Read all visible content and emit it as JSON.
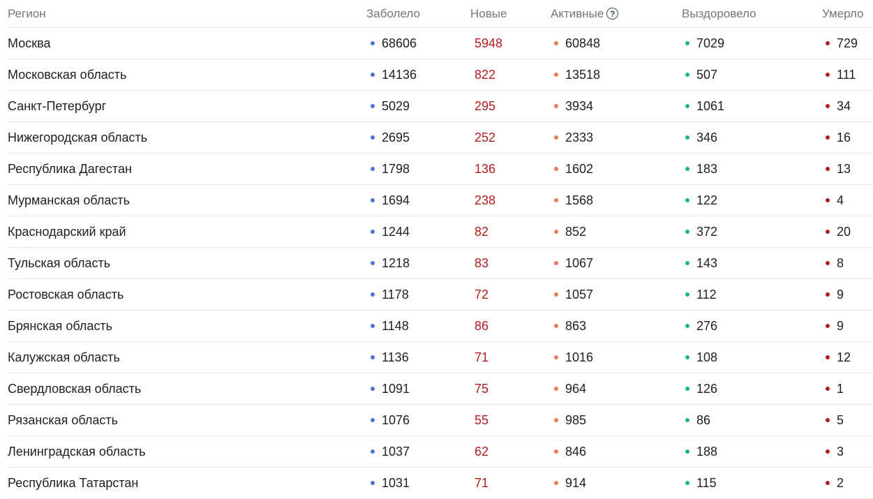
{
  "header": {
    "region": "Регион",
    "infected": "Заболело",
    "new": "Новые",
    "active": "Активные",
    "active_help": "?",
    "recovered": "Выздоровело",
    "deaths": "Умерло"
  },
  "colors": {
    "infected_dot": "#4a74d9",
    "active_dot": "#ef7a55",
    "recovered_dot": "#19b48c",
    "deaths_dot": "#b71c1c",
    "new_text": "#b71c1c"
  },
  "rows": [
    {
      "region": "Москва",
      "infected": "68606",
      "new": "5948",
      "active": "60848",
      "recovered": "7029",
      "deaths": "729"
    },
    {
      "region": "Московская область",
      "infected": "14136",
      "new": "822",
      "active": "13518",
      "recovered": "507",
      "deaths": "111"
    },
    {
      "region": "Санкт-Петербург",
      "infected": "5029",
      "new": "295",
      "active": "3934",
      "recovered": "1061",
      "deaths": "34"
    },
    {
      "region": "Нижегородская область",
      "infected": "2695",
      "new": "252",
      "active": "2333",
      "recovered": "346",
      "deaths": "16"
    },
    {
      "region": "Республика Дагестан",
      "infected": "1798",
      "new": "136",
      "active": "1602",
      "recovered": "183",
      "deaths": "13"
    },
    {
      "region": "Мурманская область",
      "infected": "1694",
      "new": "238",
      "active": "1568",
      "recovered": "122",
      "deaths": "4"
    },
    {
      "region": "Краснодарский край",
      "infected": "1244",
      "new": "82",
      "active": "852",
      "recovered": "372",
      "deaths": "20"
    },
    {
      "region": "Тульская область",
      "infected": "1218",
      "new": "83",
      "active": "1067",
      "recovered": "143",
      "deaths": "8"
    },
    {
      "region": "Ростовская область",
      "infected": "1178",
      "new": "72",
      "active": "1057",
      "recovered": "112",
      "deaths": "9"
    },
    {
      "region": "Брянская область",
      "infected": "1148",
      "new": "86",
      "active": "863",
      "recovered": "276",
      "deaths": "9"
    },
    {
      "region": "Калужская область",
      "infected": "1136",
      "new": "71",
      "active": "1016",
      "recovered": "108",
      "deaths": "12"
    },
    {
      "region": "Свердловская область",
      "infected": "1091",
      "new": "75",
      "active": "964",
      "recovered": "126",
      "deaths": "1"
    },
    {
      "region": "Рязанская область",
      "infected": "1076",
      "new": "55",
      "active": "985",
      "recovered": "86",
      "deaths": "5"
    },
    {
      "region": "Ленинградская область",
      "infected": "1037",
      "new": "62",
      "active": "846",
      "recovered": "188",
      "deaths": "3"
    },
    {
      "region": "Республика Татарстан",
      "infected": "1031",
      "new": "71",
      "active": "914",
      "recovered": "115",
      "deaths": "2"
    }
  ]
}
